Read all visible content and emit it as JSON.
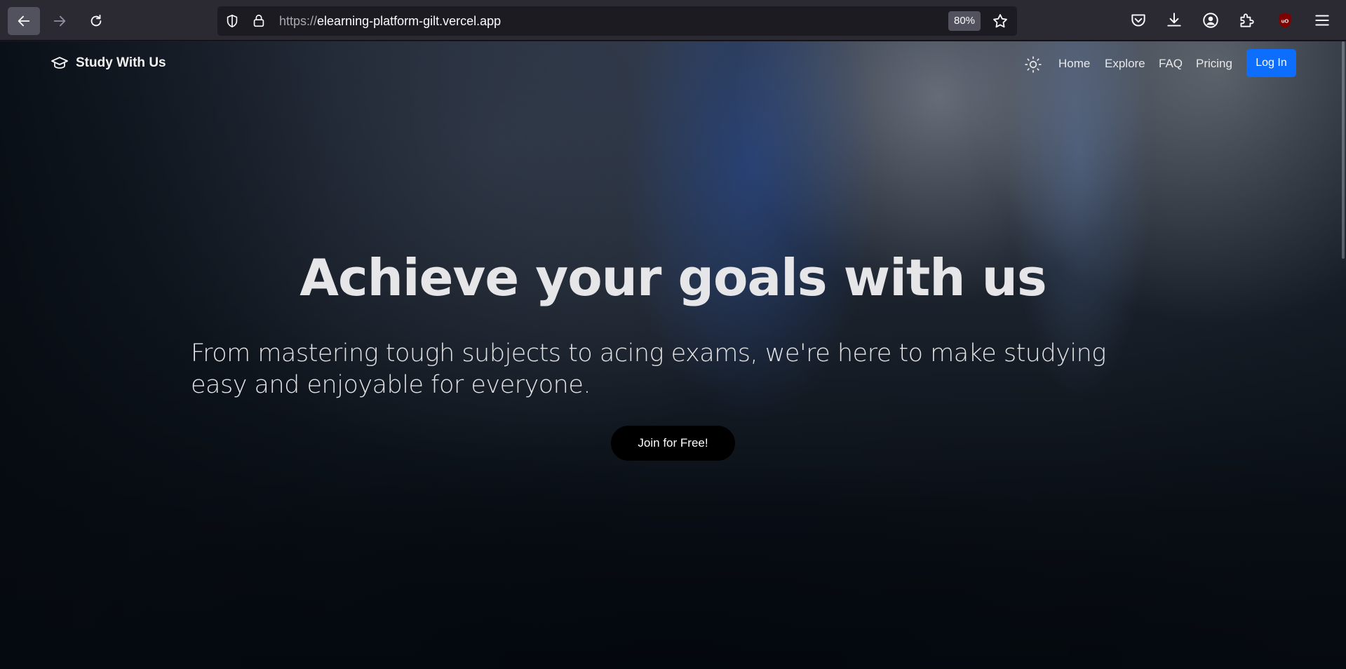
{
  "browser": {
    "url_scheme": "https://",
    "url_host": "elearning-platform-gilt.vercel.app",
    "zoom": "80%",
    "icons": {
      "back": "arrow-left-icon",
      "forward": "arrow-right-icon",
      "reload": "reload-icon",
      "shield": "tracking-shield-icon",
      "lock": "lock-icon",
      "bookmark": "star-icon",
      "pocket": "pocket-icon",
      "downloads": "download-icon",
      "account": "account-icon",
      "extensions": "puzzle-icon",
      "ublock": "ublock-origin-icon",
      "menu": "hamburger-menu-icon"
    }
  },
  "site": {
    "brand": "Study With Us",
    "brand_icon": "graduation-cap-icon",
    "theme_icon": "sun-icon",
    "nav": {
      "home": "Home",
      "explore": "Explore",
      "faq": "FAQ",
      "pricing": "Pricing"
    },
    "login": "Log In",
    "accent": "#0d6efd"
  },
  "hero": {
    "title": "Achieve your goals with us",
    "subtitle": "From mastering tough subjects to acing exams, we're here to make studying easy and enjoyable for everyone.",
    "cta": "Join for Free!"
  }
}
